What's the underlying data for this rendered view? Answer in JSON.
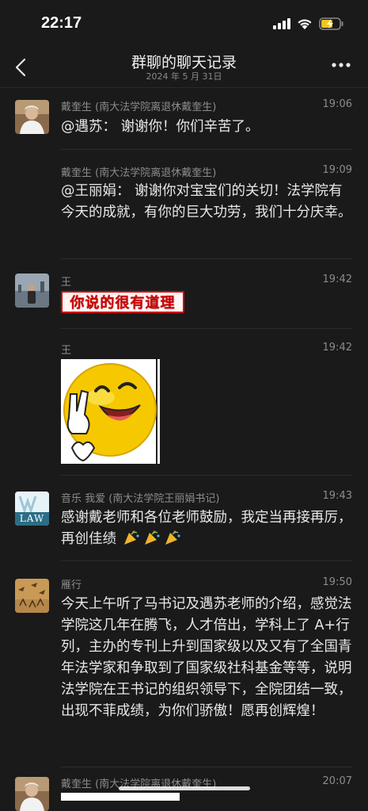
{
  "status": {
    "time": "22:17"
  },
  "nav": {
    "title": "群聊的聊天记录",
    "date": "2024 年 5 月 31日"
  },
  "messages": [
    {
      "sender": "戴奎生 (南大法学院离退休戴奎生)",
      "time": "19:06",
      "text": "@遇苏： 谢谢你！你们辛苦了。"
    },
    {
      "sender": "戴奎生 (南大法学院离退休戴奎生)",
      "time": "19:09",
      "text": "@王丽娟： 谢谢你对宝宝们的关切！法学院有今天的成就，有你的巨大功劳，我们十分庆幸。"
    },
    {
      "sender": "王",
      "time": "19:42",
      "sticker_text": "你说的很有道理"
    },
    {
      "sender": "王",
      "time": "19:42"
    },
    {
      "sender": "音乐 我爱 (南大法学院王丽娟书记)",
      "time": "19:43",
      "text": "感谢戴老师和各位老师鼓励，我定当再接再厉，再创佳绩",
      "avatar_text": "LAW"
    },
    {
      "sender": "雁行",
      "time": "19:50",
      "text": "今天上午听了马书记及遇苏老师的介绍，感觉法学院这几年在腾飞，人才倍出，学科上了 A+行列，主办的专刊上升到国家级以及又有了全国青年法学家和争取到了国家级社科基金等等，说明法学院在王书记的组织领导下，全院团结一致，出现不菲成绩，为你们骄傲！愿再创辉煌！"
    },
    {
      "sender": "戴奎生 (南大法学院离退休戴奎生)",
      "time": "20:07"
    }
  ]
}
